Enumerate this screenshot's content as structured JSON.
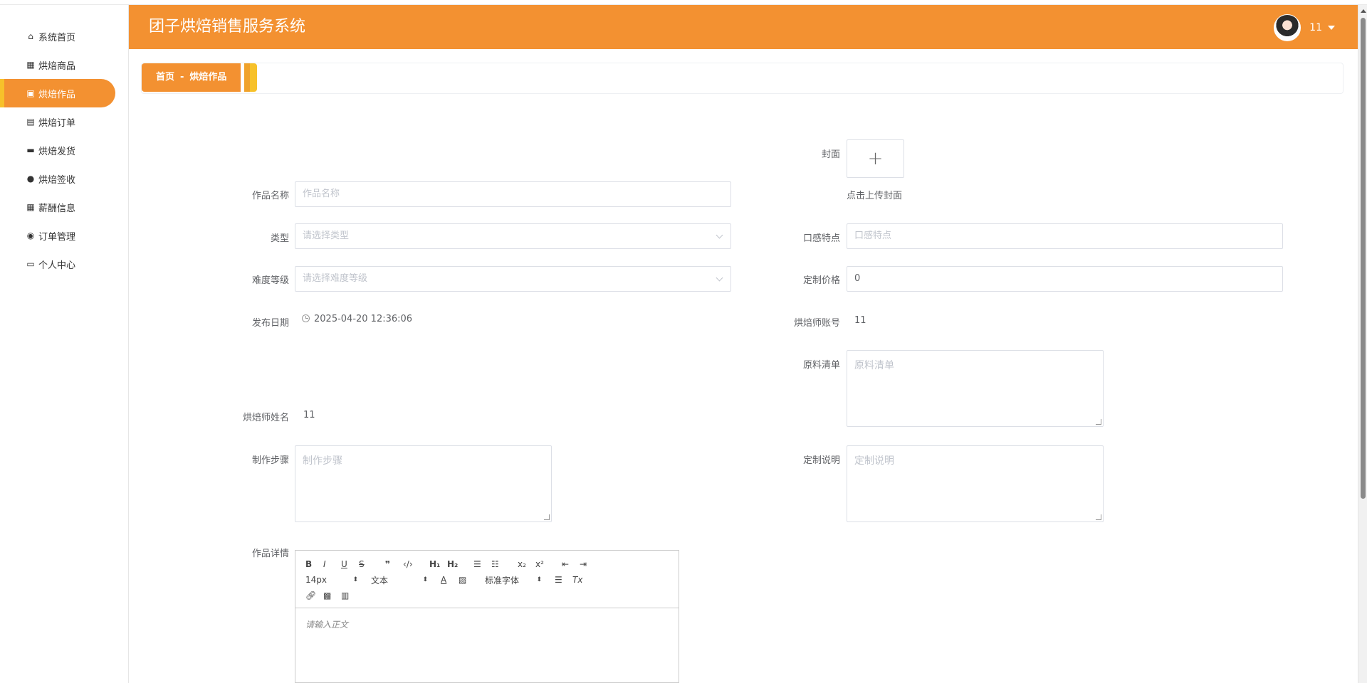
{
  "app": {
    "title": "团子烘焙销售服务系统",
    "user_name": "11"
  },
  "sidebar": {
    "items": [
      {
        "label": "系统首页",
        "icon": "home-icon"
      },
      {
        "label": "烘焙商品",
        "icon": "grid-icon"
      },
      {
        "label": "烘焙作品",
        "icon": "briefcase-icon",
        "active": true
      },
      {
        "label": "烘焙订单",
        "icon": "clipboard-icon"
      },
      {
        "label": "烘焙发货",
        "icon": "monitor-icon"
      },
      {
        "label": "烘焙签收",
        "icon": "user-icon"
      },
      {
        "label": "薪酬信息",
        "icon": "grid-icon"
      },
      {
        "label": "订单管理",
        "icon": "pin-icon"
      },
      {
        "label": "个人中心",
        "icon": "calendar-icon"
      }
    ]
  },
  "breadcrumb": {
    "home": "首页",
    "separator": "-",
    "current": "烘焙作品"
  },
  "form": {
    "cover_label": "封面",
    "cover_hint": "点击上传封面",
    "name_label": "作品名称",
    "name_placeholder": "作品名称",
    "type_label": "类型",
    "type_placeholder": "请选择类型",
    "taste_label": "口感特点",
    "taste_placeholder": "口感特点",
    "difficulty_label": "难度等级",
    "difficulty_placeholder": "请选择难度等级",
    "price_label": "定制价格",
    "price_value": "0",
    "date_label": "发布日期",
    "date_value": "2025-04-20 12:36:06",
    "baker_account_label": "烘焙师账号",
    "baker_account_value": "11",
    "ingredients_label": "原料清单",
    "ingredients_placeholder": "原料清单",
    "baker_name_label": "烘焙师姓名",
    "baker_name_value": "11",
    "steps_label": "制作步骤",
    "steps_placeholder": "制作步骤",
    "custom_label": "定制说明",
    "custom_placeholder": "定制说明",
    "detail_label": "作品详情"
  },
  "editor": {
    "font_size": "14px",
    "paragraph": "文本",
    "font_family": "标准字体",
    "placeholder": "请输入正文"
  },
  "colors": {
    "accent": "#f39131",
    "accent_secondary": "#f7c12a"
  }
}
